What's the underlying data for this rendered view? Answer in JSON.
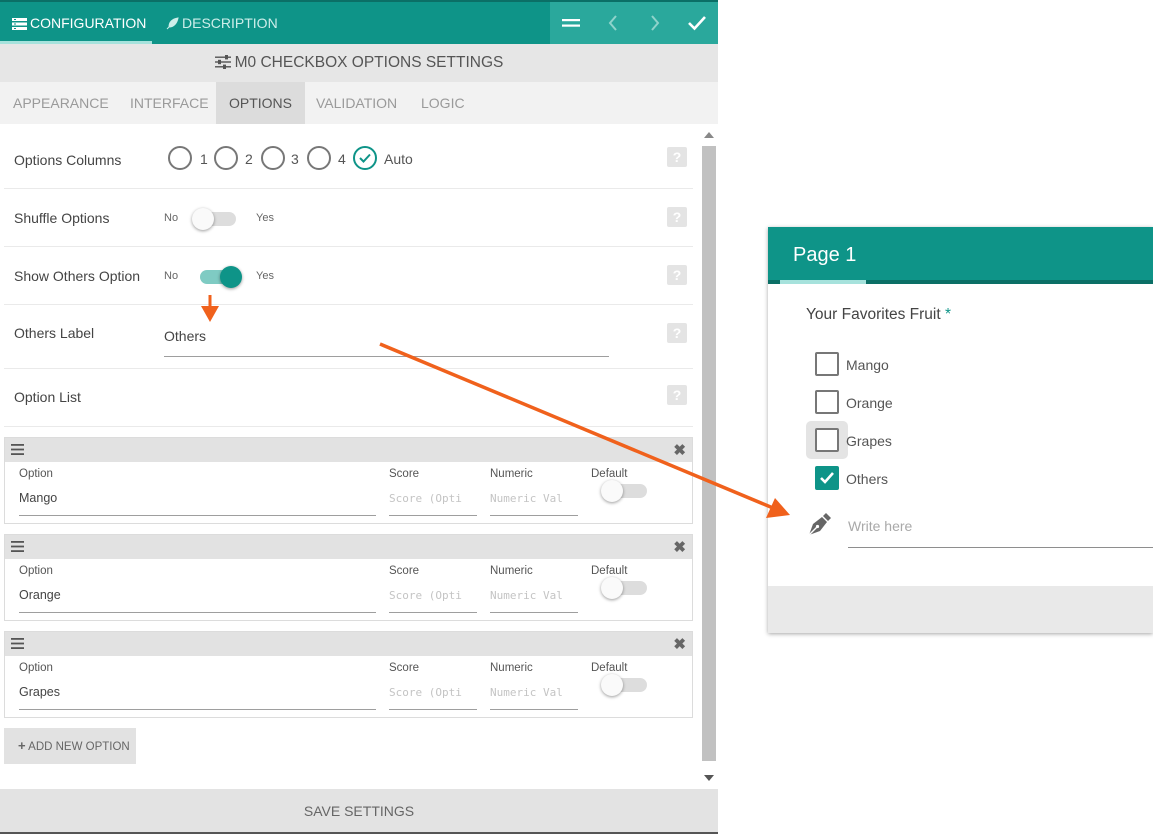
{
  "topbar": {
    "tabs": [
      {
        "label": "CONFIGURATION",
        "icon": "config-list-icon"
      },
      {
        "label": "DESCRIPTION",
        "icon": "feather-icon"
      }
    ],
    "actions": [
      "menu-icon",
      "prev-chevron-icon",
      "next-chevron-icon",
      "check-icon"
    ]
  },
  "settings_title": "M0 CHECKBOX OPTIONS SETTINGS",
  "subtabs": [
    {
      "label": "APPEARANCE"
    },
    {
      "label": "INTERFACE"
    },
    {
      "label": "OPTIONS"
    },
    {
      "label": "VALIDATION"
    },
    {
      "label": "LOGIC"
    }
  ],
  "active_subtab": "OPTIONS",
  "rows": {
    "options_columns": {
      "label": "Options Columns",
      "choices": [
        "1",
        "2",
        "3",
        "4",
        "Auto"
      ],
      "selected": "Auto"
    },
    "shuffle_options": {
      "label": "Shuffle Options",
      "off": "No",
      "on": "Yes",
      "value": false
    },
    "show_others": {
      "label": "Show Others Option",
      "off": "No",
      "on": "Yes",
      "value": true
    },
    "others_label": {
      "label": "Others Label",
      "value": "Others"
    },
    "option_list": {
      "label": "Option List"
    }
  },
  "option_headers": {
    "option": "Option",
    "score": "Score",
    "numeric": "Numeric",
    "default": "Default"
  },
  "option_placeholders": {
    "score": "Score (Opti",
    "numeric": "Numeric Val"
  },
  "options": [
    {
      "value": "Mango",
      "default": false
    },
    {
      "value": "Orange",
      "default": false
    },
    {
      "value": "Grapes",
      "default": false
    }
  ],
  "add_button": "ADD NEW OPTION",
  "save_button": "SAVE SETTINGS",
  "preview": {
    "page_title": "Page 1",
    "question": "Your Favorites Fruit",
    "required_mark": "*",
    "choices": [
      {
        "label": "Mango",
        "checked": false
      },
      {
        "label": "Orange",
        "checked": false
      },
      {
        "label": "Grapes",
        "checked": false
      },
      {
        "label": "Others",
        "checked": true
      }
    ],
    "others_placeholder": "Write here"
  },
  "colors": {
    "accent": "#0e9488",
    "arrow": "#f0611c"
  }
}
